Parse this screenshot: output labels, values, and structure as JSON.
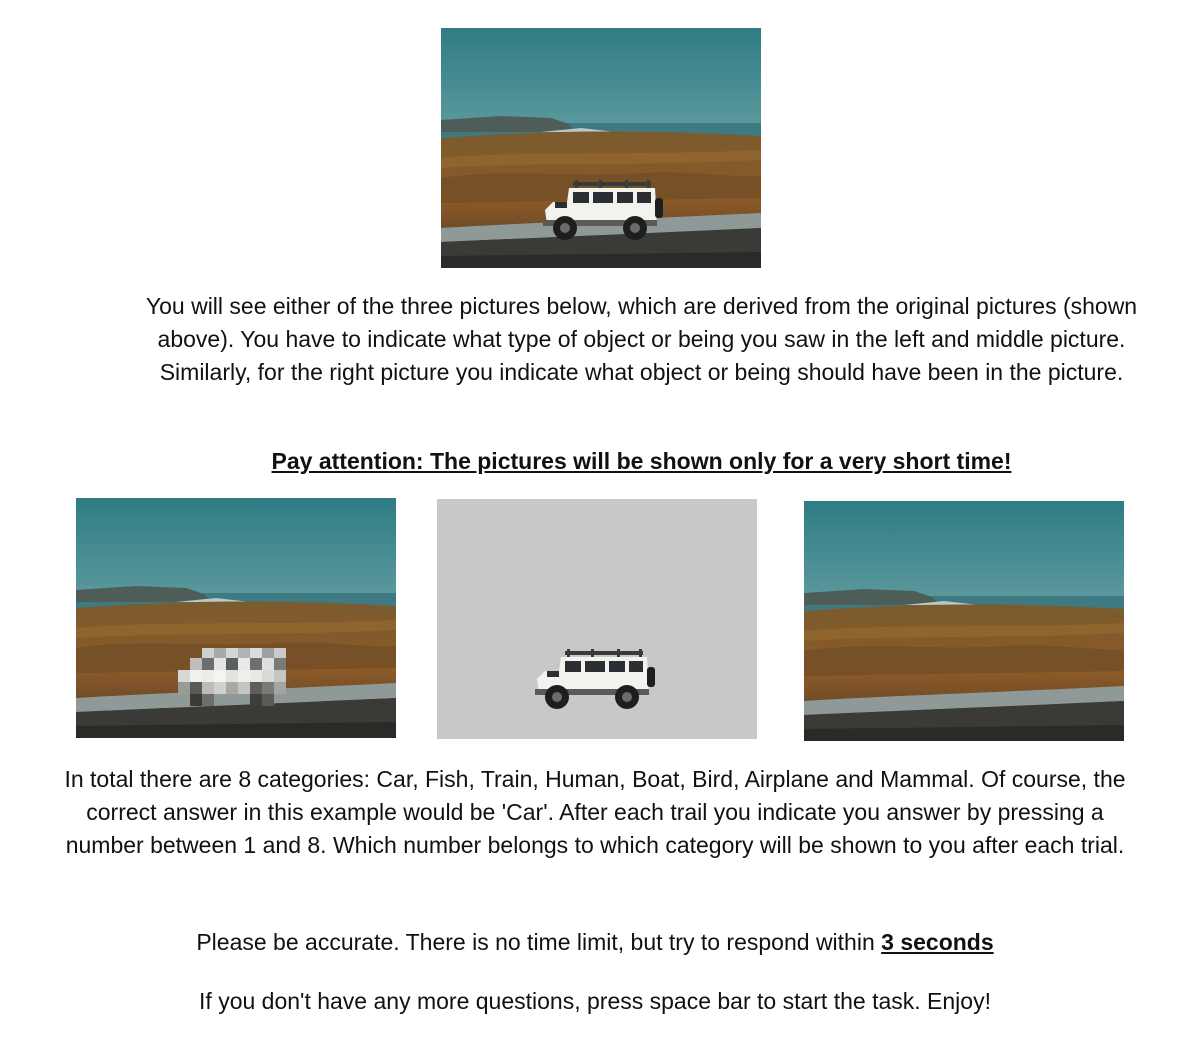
{
  "intro": {
    "text": "You will see either of the three pictures below, which are derived from the original pictures (shown above). You have to indicate what type of object or being you saw in the left and middle picture. Similarly, for the right picture you indicate what object or being should have been in the picture."
  },
  "warning": {
    "text": "Pay attention: The pictures will be shown only for a very short time!"
  },
  "categories": {
    "text": "In total there are 8 categories: Car, Fish, Train, Human, Boat, Bird, Airplane and Mammal. Of course, the correct answer in this example would be 'Car'. After each trail you indicate you answer by pressing a number between 1 and 8. Which number belongs to which category will be shown to you after each trial."
  },
  "accuracy": {
    "prefix": "Please be accurate. There is no time limit, but try to respond within ",
    "emphasis": "3 seconds"
  },
  "closing": {
    "text": "If you don't have any more questions, press space bar to start the task. Enjoy!"
  },
  "images": {
    "original": "original-landscape-with-car",
    "left": "landscape-with-pixelated-car",
    "middle": "car-on-grey-background",
    "right": "landscape-without-car"
  },
  "colors": {
    "sky": "#3f8a8f",
    "ground": "#8a5a2a",
    "sea": "#2f6f78",
    "grey": "#c8c8c8"
  }
}
